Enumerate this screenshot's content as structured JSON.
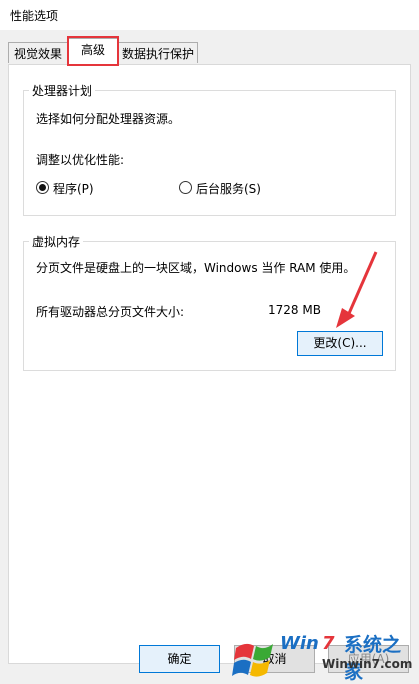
{
  "window": {
    "title": "性能选项"
  },
  "tabs": [
    {
      "label": "视觉效果"
    },
    {
      "label": "高级"
    },
    {
      "label": "数据执行保护"
    }
  ],
  "processor": {
    "legend": "处理器计划",
    "description": "选择如何分配处理器资源。",
    "adjust_label": "调整以优化性能:",
    "options": [
      {
        "label": "程序(P)",
        "checked": true
      },
      {
        "label": "后台服务(S)",
        "checked": false
      }
    ]
  },
  "virtual_memory": {
    "legend": "虚拟内存",
    "description": "分页文件是硬盘上的一块区域，Windows 当作 RAM 使用。",
    "total_label": "所有驱动器总分页文件大小:",
    "total_value": "1728 MB",
    "change_button": "更改(C)..."
  },
  "footer": {
    "ok_button": "确定",
    "cancel_button": "取消",
    "apply_button": "应用(A)"
  },
  "watermark": {
    "text": "系统之家",
    "url": "Winwin7.com",
    "colors": {
      "red": "#e5353b",
      "green": "#3aa935",
      "blue": "#1b6fc3",
      "yellow": "#f5b800"
    }
  },
  "annotation": {
    "color": "#e5353b"
  }
}
